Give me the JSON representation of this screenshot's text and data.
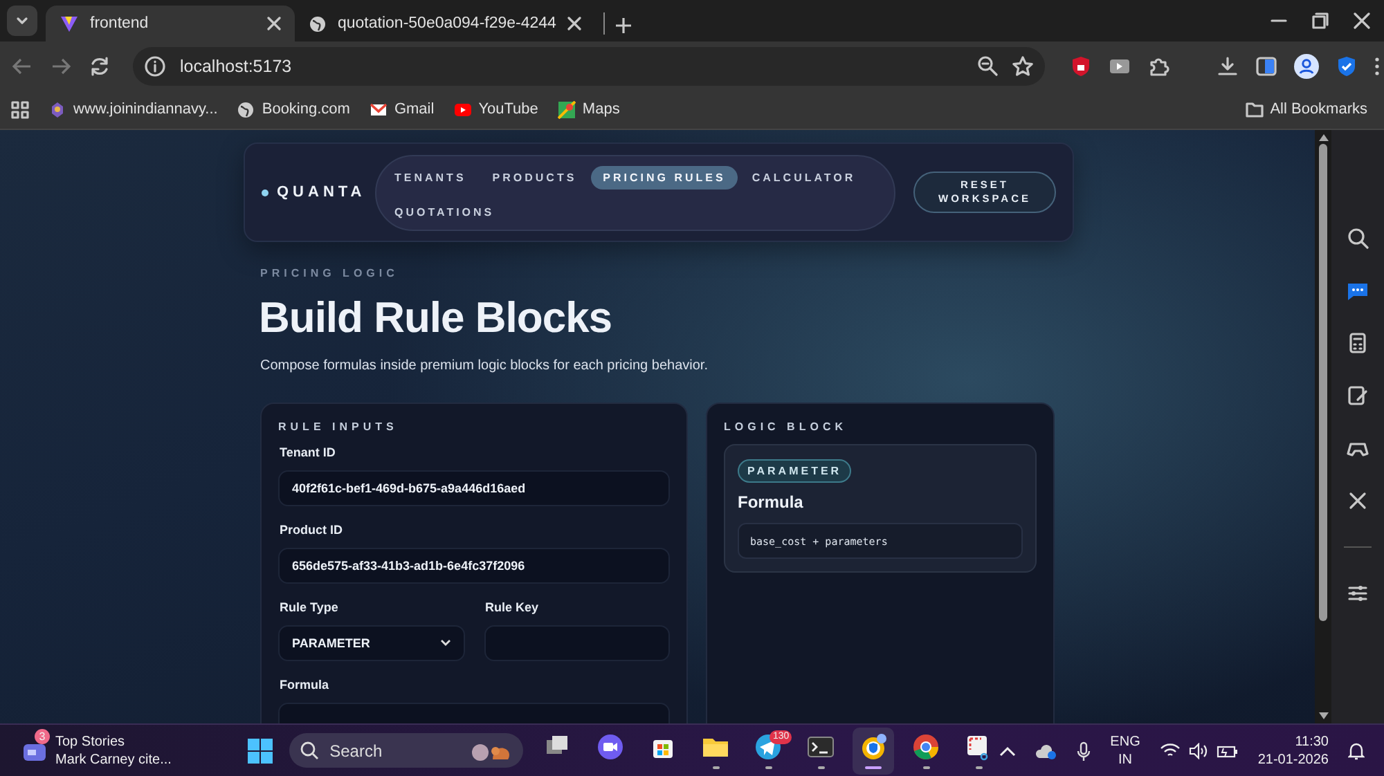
{
  "browser": {
    "tabs": [
      {
        "title": "frontend",
        "selected": true
      },
      {
        "title": "quotation-50e0a094-f29e-4244",
        "selected": false
      }
    ],
    "address": "localhost:5173",
    "bookmarks": [
      {
        "label": "www.joinindiannavy...",
        "kind": "crest"
      },
      {
        "label": "Booking.com",
        "kind": "globe"
      },
      {
        "label": "Gmail",
        "kind": "mail"
      },
      {
        "label": "YouTube",
        "kind": "video"
      },
      {
        "label": "Maps",
        "kind": "map"
      }
    ],
    "all_bookmarks": "All Bookmarks"
  },
  "app": {
    "brand": "QUANTA",
    "nav": [
      {
        "label": "TENANTS",
        "selected": false
      },
      {
        "label": "PRODUCTS",
        "selected": false
      },
      {
        "label": "PRICING RULES",
        "selected": true
      },
      {
        "label": "CALCULATOR",
        "selected": false
      },
      {
        "label": "QUOTATIONS",
        "selected": false
      }
    ],
    "reset_button": "RESET WORKSPACE",
    "eyebrow": "PRICING LOGIC",
    "title": "Build Rule Blocks",
    "subtitle": "Compose formulas inside premium logic blocks for each pricing behavior.",
    "inputs_panel": {
      "heading": "RULE INPUTS",
      "fields": [
        {
          "label": "Tenant ID",
          "value": "40f2f61c-bef1-469d-b675-a9a446d16aed",
          "kind": "text"
        },
        {
          "label": "Product ID",
          "value": "656de575-af33-41b3-ad1b-6e4fc37f2096",
          "kind": "text"
        },
        {
          "kind": "row",
          "fields": [
            {
              "label": "Rule Type",
              "value": "PARAMETER",
              "kind": "select"
            },
            {
              "label": "Rule Key",
              "kind": "text"
            }
          ]
        },
        {
          "label": "Formula",
          "kind": "text"
        }
      ]
    },
    "logic_panel": {
      "heading": "LOGIC BLOCK",
      "badge": "PARAMETER",
      "title": "Formula",
      "code": "base_cost + parameters"
    }
  },
  "taskbar": {
    "news": {
      "badge": "3",
      "title": "Top Stories",
      "subtitle": "Mark Carney cite..."
    },
    "search": {
      "placeholder": "Search"
    },
    "apps": [
      {
        "kind": "taskview",
        "running": false,
        "selected": false
      },
      {
        "kind": "meet",
        "running": false,
        "selected": false
      },
      {
        "kind": "store",
        "running": false,
        "selected": false
      },
      {
        "kind": "files",
        "running": true,
        "selected": false
      },
      {
        "kind": "telegram",
        "badge": "130",
        "running": true,
        "selected": false
      },
      {
        "kind": "terminal",
        "running": true,
        "selected": false
      },
      {
        "kind": "browser",
        "running": true,
        "selected": true
      },
      {
        "kind": "chrome",
        "running": true,
        "selected": false
      },
      {
        "kind": "snip",
        "running": true,
        "selected": false
      }
    ],
    "language": "ENG",
    "region": "IN",
    "time": "11:30",
    "date": "21-01-2026"
  }
}
